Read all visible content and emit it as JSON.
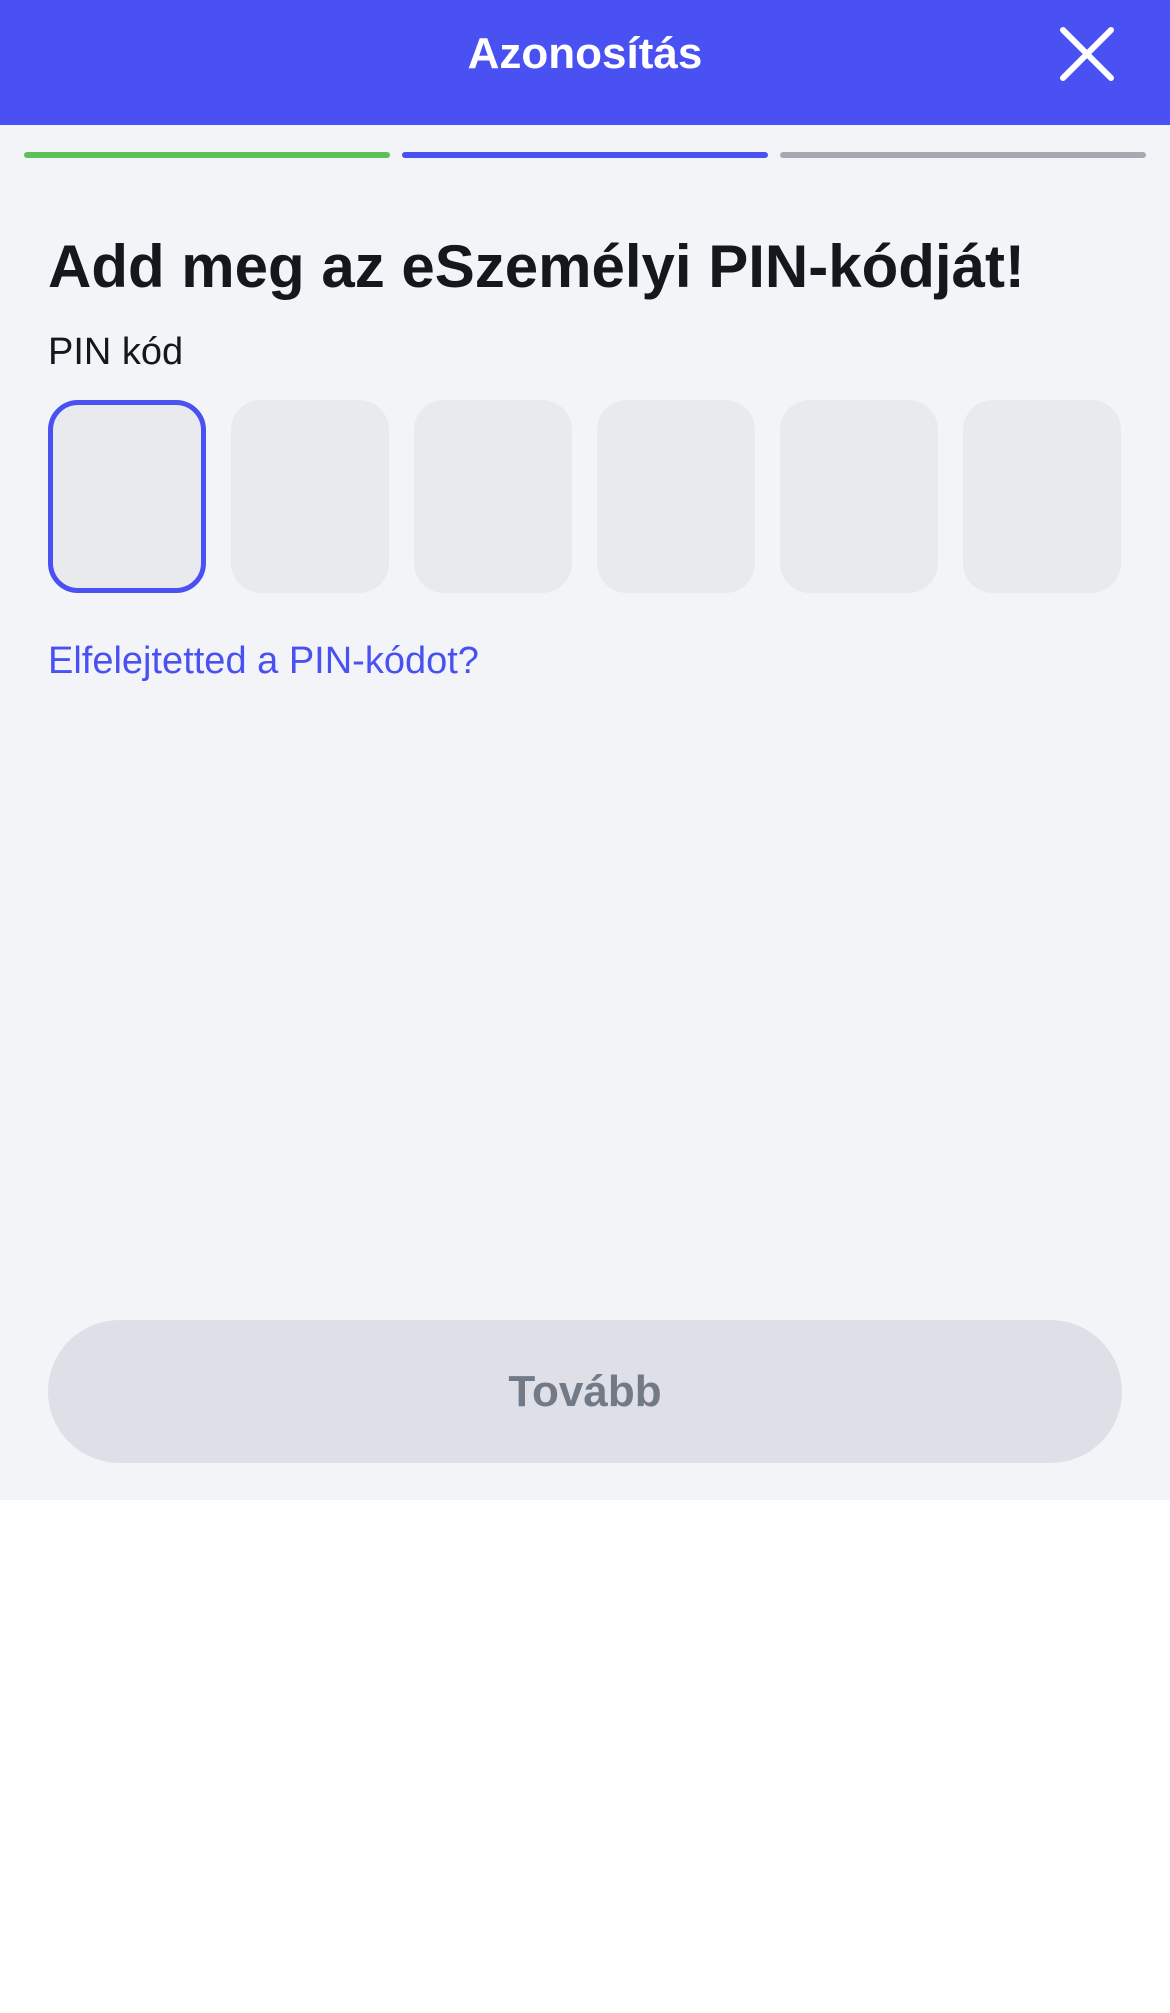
{
  "header": {
    "title": "Azonosítás",
    "close_icon": "close-icon"
  },
  "progress": {
    "steps": [
      {
        "state": "completed",
        "color": "#5cbf5a"
      },
      {
        "state": "current",
        "color": "#4a51f2"
      },
      {
        "state": "upcoming",
        "color": "#a4a9b4"
      }
    ]
  },
  "main": {
    "heading": "Add meg az eSzemélyi PIN-kódját!",
    "pin_label": "PIN kód",
    "pin_digits": [
      "",
      "",
      "",
      "",
      "",
      ""
    ],
    "forgot_link": "Elfelejtetted a PIN-kódot?",
    "next_button": "Tovább"
  },
  "colors": {
    "accent": "#4a51f2",
    "background": "#f3f4f8",
    "disabled_button": "#dfe0e7",
    "disabled_text": "#727a88"
  }
}
